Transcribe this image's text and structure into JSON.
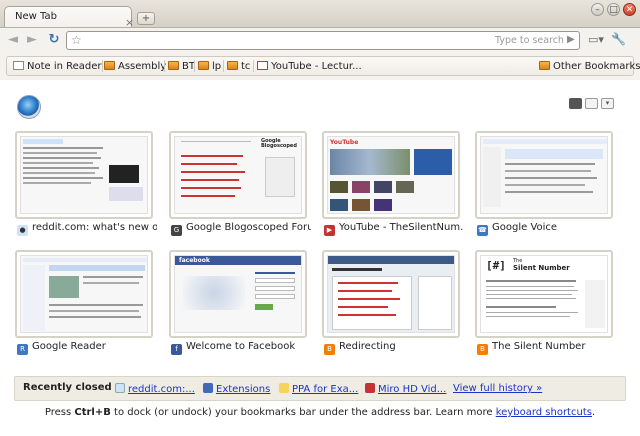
{
  "window": {
    "minimize": "–",
    "maximize": "□",
    "close": "✕"
  },
  "tab": {
    "title": "New Tab",
    "close": "×",
    "new_tab": "+"
  },
  "toolbar": {
    "back": "◄",
    "forward": "►",
    "reload": "↻",
    "address_value": "",
    "address_placeholder": "",
    "hint": "Type to search",
    "star": "☆",
    "go": "▶",
    "page_menu": "▭▾",
    "wrench_menu": "🔧"
  },
  "bookmarks": {
    "items": [
      {
        "label": "Note in Reader",
        "icon": "page-icon"
      },
      {
        "label": "Assembly",
        "icon": "folder-icon"
      },
      {
        "label": "BT",
        "icon": "folder-icon"
      },
      {
        "label": "lp",
        "icon": "folder-icon"
      },
      {
        "label": "tc",
        "icon": "folder-icon"
      },
      {
        "label": "YouTube - Lectur...",
        "icon": "youtube-icon"
      }
    ],
    "other": "Other Bookmarks"
  },
  "view_menu": "▾",
  "thumbnails": [
    {
      "title": "reddit.com: what's new o...",
      "favicon": "reddit-icon",
      "color": "#6f8fb9"
    },
    {
      "title": "Google Blogoscoped Forum",
      "favicon": "blogoscoped-icon",
      "color": "#444444"
    },
    {
      "title": "YouTube - TheSilentNum...",
      "favicon": "youtube-icon",
      "color": "#c33333"
    },
    {
      "title": "Google Voice",
      "favicon": "voice-icon",
      "color": "#3d78c4"
    },
    {
      "title": "Google Reader",
      "favicon": "reader-icon",
      "color": "#3d78c4"
    },
    {
      "title": "Welcome to Facebook",
      "favicon": "facebook-icon",
      "color": "#3b5998"
    },
    {
      "title": "Redirecting",
      "favicon": "blogger-icon",
      "color": "#f57d00"
    },
    {
      "title": "The Silent Number",
      "favicon": "blogger-icon",
      "color": "#f57d00"
    }
  ],
  "thumbnail_snippets": {
    "silent_brand": "[#]",
    "silent_the": "The",
    "silent_name": "Silent Number",
    "blogo_brand": "Google Blogoscoped",
    "youtube_brand": "YouTube",
    "facebook_brand": "facebook"
  },
  "recently_closed": {
    "label": "Recently closed",
    "items": [
      {
        "label": "reddit.com:...",
        "icon": "reddit-icon"
      },
      {
        "label": "Extensions",
        "icon": "puzzle-icon"
      },
      {
        "label": "PPA for Exa...",
        "icon": "launchpad-icon"
      },
      {
        "label": "Miro HD Vid...",
        "icon": "miro-icon"
      }
    ],
    "history": "View full history »"
  },
  "footer": {
    "press": "Press ",
    "keys": "Ctrl+B",
    "rest": " to dock (or undock) your bookmarks bar under the address bar. Learn more ",
    "link": "keyboard shortcuts",
    "end": "."
  }
}
